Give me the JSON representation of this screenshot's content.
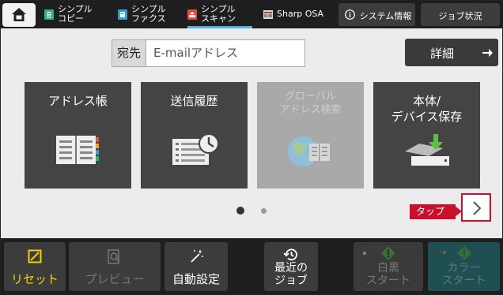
{
  "topbar": {
    "tabs": [
      {
        "label_line1": "シンプル",
        "label_line2": "コピー",
        "icon": "copy-icon"
      },
      {
        "label_line1": "シンプル",
        "label_line2": "ファクス",
        "icon": "fax-icon"
      },
      {
        "label_line1": "シンプル",
        "label_line2": "スキャン",
        "icon": "scan-icon"
      },
      {
        "label_line1": "Sharp OSA",
        "icon": "osa-icon"
      }
    ],
    "system_info": "システム情報",
    "job_status": "ジョブ状況"
  },
  "destination": {
    "label": "宛先",
    "value": "E-mailアドレス"
  },
  "detail_label": "詳細",
  "tiles": [
    {
      "line1": "アドレス帳",
      "line2": "",
      "icon": "address-book-icon",
      "enabled": true
    },
    {
      "line1": "送信履歴",
      "line2": "",
      "icon": "send-history-icon",
      "enabled": true
    },
    {
      "line1": "グローバル",
      "line2": "アドレス検索",
      "icon": "global-search-icon",
      "enabled": false
    },
    {
      "line1": "本体/",
      "line2": "デバイス保存",
      "icon": "device-save-icon",
      "enabled": true
    }
  ],
  "pager": {
    "current": 1,
    "total": 2
  },
  "tap_callout": "タップ",
  "bottom": {
    "reset": "リセット",
    "preview": "プレビュー",
    "auto_setting": "自動設定",
    "recent_jobs_line1": "最近の",
    "recent_jobs_line2": "ジョブ",
    "bw_start_line1": "白黒",
    "bw_start_line2": "スタート",
    "color_start_line1": "カラー",
    "color_start_line2": "スタート"
  },
  "colors": {
    "accent": "#4db6e9",
    "callout": "#c8102e",
    "reset_yellow": "#f4d000",
    "start_green": "#2e8b57"
  }
}
